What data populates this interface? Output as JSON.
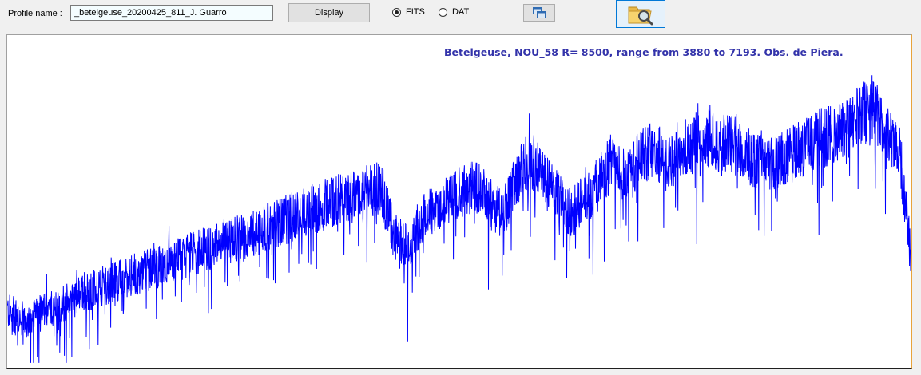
{
  "toolbar": {
    "profile_label": "Profile name :",
    "profile_value": "_betelgeuse_20200425_811_J. Guarro",
    "display_label": "Display",
    "radio_fits": "FITS",
    "radio_dat": "DAT",
    "selected_format": "FITS",
    "copy_icon": "copy-windows-icon",
    "open_icon": "folder-search-icon"
  },
  "plot": {
    "title": "Betelgeuse, NOU_58 R= 8500, range from 3880 to 7193. Obs. de Piera.",
    "line_color": "#0000ff",
    "title_color": "#3333aa"
  },
  "chart_data": {
    "type": "line",
    "title": "Betelgeuse, NOU_58 R= 8500, range from 3880 to 7193. Obs. de Piera.",
    "xlabel": "",
    "ylabel": "",
    "xlim": [
      3880,
      7193
    ],
    "ylim": [
      0,
      1
    ],
    "grid": false,
    "series": [
      {
        "x": [
          3880,
          3950,
          4050,
          4150,
          4300,
          4450,
          4600,
          4750,
          4900,
          5050,
          5150,
          5250,
          5300,
          5350,
          5400,
          5500,
          5600,
          5650,
          5700,
          5750,
          5800,
          5850,
          5950,
          6050,
          6100,
          6150,
          6250,
          6300,
          6350,
          6450,
          6550,
          6650,
          6750,
          6850,
          6950,
          7000,
          7050,
          7100,
          7150,
          7193
        ],
        "values": [
          0.17,
          0.14,
          0.18,
          0.22,
          0.27,
          0.31,
          0.36,
          0.4,
          0.45,
          0.5,
          0.53,
          0.55,
          0.4,
          0.37,
          0.45,
          0.52,
          0.56,
          0.5,
          0.47,
          0.58,
          0.64,
          0.57,
          0.47,
          0.56,
          0.64,
          0.58,
          0.68,
          0.62,
          0.67,
          0.7,
          0.68,
          0.62,
          0.65,
          0.7,
          0.72,
          0.78,
          0.8,
          0.72,
          0.68,
          0.35
        ]
      }
    ]
  }
}
